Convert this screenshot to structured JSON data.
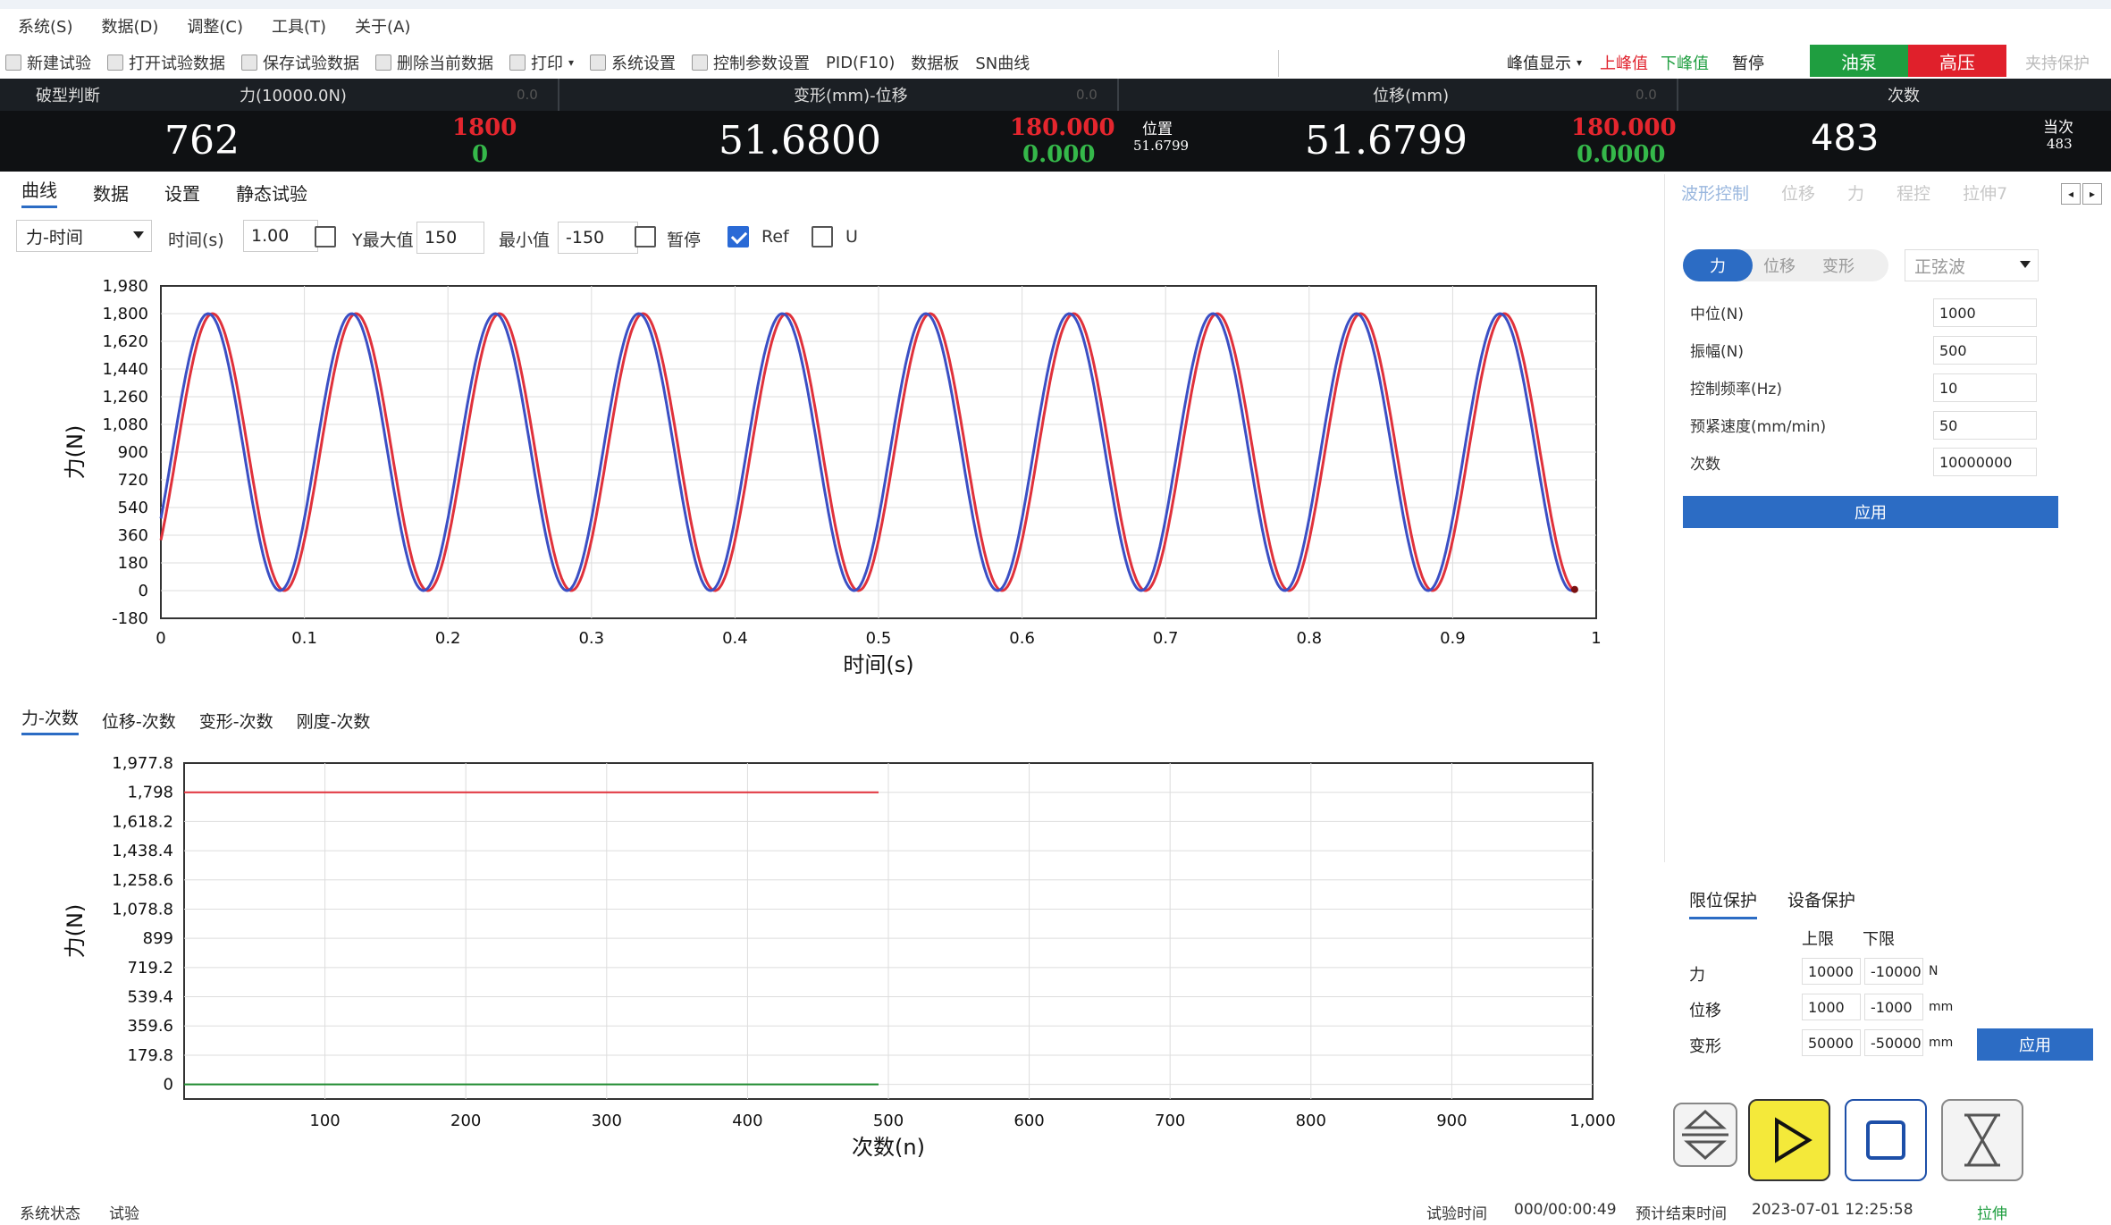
{
  "menu": [
    "系统(S)",
    "数据(D)",
    "调整(C)",
    "工具(T)",
    "关于(A)"
  ],
  "toolbar": {
    "items": [
      "新建试验",
      "打开试验数据",
      "保存试验数据",
      "删除当前数据",
      "打印",
      "系统设置",
      "控制参数设置",
      "PID(F10)",
      "数据板",
      "SN曲线"
    ],
    "peak_display": "峰值显示",
    "upper_peak": "上峰值",
    "lower_peak": "下峰值",
    "pause": "暂停",
    "oil_pump": "油泵",
    "high_pressure": "高压",
    "keep_protect": "夹持保护"
  },
  "readout": {
    "break_label": "破型判断",
    "force_label": "力(10000.0N)",
    "force_small": "0.0",
    "deform_label": "变形(mm)-位移",
    "deform_small": "0.0",
    "disp_label": "位移(mm)",
    "disp_small": "0.0",
    "count_label": "次数",
    "force_value": "762",
    "force_peak_hi": "1800",
    "force_peak_lo": "0",
    "deform_value": "51.6800",
    "deform_peak_hi": "180.000",
    "deform_peak_lo": "0.000",
    "pos_label": "位置",
    "pos_value": "51.6799",
    "disp_value": "51.6799",
    "disp_peak_hi": "180.000",
    "disp_peak_lo": "0.0000",
    "count_value": "483",
    "current_label": "当次",
    "current_value": "483"
  },
  "main_tabs": [
    "曲线",
    "数据",
    "设置",
    "静态试验"
  ],
  "controls": {
    "mode": "力-时间",
    "time_label": "时间(s)",
    "time_value": "1.00",
    "ymax_label": "Y最大值",
    "ymax_value": "150",
    "ymin_label": "最小值",
    "ymin_value": "-150",
    "pause_label": "暂停",
    "pause_checked": false,
    "ymax_checked": false,
    "ref_label": "Ref",
    "ref_checked": true,
    "u_label": "U",
    "u_checked": false
  },
  "bottom_tabs": [
    "力-次数",
    "位移-次数",
    "变形-次数",
    "刚度-次数"
  ],
  "right_panel": {
    "tabs": [
      "波形控制",
      "位移",
      "力",
      "程控",
      "拉伸7"
    ],
    "seg": [
      "力",
      "位移",
      "变形"
    ],
    "wave": "正弦波",
    "fields": [
      {
        "label": "中位(N)",
        "value": "1000"
      },
      {
        "label": "振幅(N)",
        "value": "500"
      },
      {
        "label": "控制频率(Hz)",
        "value": "10"
      },
      {
        "label": "预紧速度(mm/min)",
        "value": "50"
      },
      {
        "label": "次数",
        "value": "10000000"
      }
    ],
    "apply": "应用"
  },
  "limits": {
    "tabs": [
      "限位保护",
      "设备保护"
    ],
    "upper": "上限",
    "lower": "下限",
    "rows": [
      {
        "label": "力",
        "hi": "10000",
        "lo": "-10000",
        "unit": "N"
      },
      {
        "label": "位移",
        "hi": "1000",
        "lo": "-1000",
        "unit": "mm"
      },
      {
        "label": "变形",
        "hi": "50000",
        "lo": "-50000",
        "unit": "mm"
      }
    ],
    "apply": "应用"
  },
  "status": {
    "sys_state_label": "系统状态",
    "sys_state": "试验",
    "test_time_label": "试验时间",
    "test_time": "000/00:00:49",
    "end_time_label": "预计结束时间",
    "end_time": "2023-07-01 12:25:58",
    "mode": "拉伸"
  },
  "colors": {
    "ref_series": "#e0313b",
    "feedback_series": "#3b4fc4",
    "min_series": "#1e8a2e",
    "accent": "#2c6cc4"
  },
  "chart_data": [
    {
      "type": "line",
      "title": "",
      "xlabel": "时间(s)",
      "ylabel": "力(N)",
      "xlim": [
        0,
        1
      ],
      "ylim": [
        -180,
        1980
      ],
      "xticks": [
        "0",
        "0.1",
        "0.2",
        "0.3",
        "0.4",
        "0.5",
        "0.6",
        "0.7",
        "0.8",
        "0.9",
        "1"
      ],
      "yticks": [
        "1,980",
        "1,800",
        "1,620",
        "1,440",
        "1,260",
        "1,080",
        "900",
        "720",
        "540",
        "360",
        "180",
        "0",
        "-180"
      ],
      "series": [
        {
          "name": "Ref",
          "frequency_hz": 10,
          "min": 0,
          "max": 1800,
          "start_x": 0,
          "end_x": 0.985,
          "phase_shift": 0.0
        },
        {
          "frequency_hz": 10,
          "min": 0,
          "max": 1800,
          "start_x": 0,
          "end_x": 0.985,
          "phase_shift": 0.003
        }
      ],
      "grid": true
    },
    {
      "type": "line",
      "title": "",
      "xlabel": "次数(n)",
      "ylabel": "力(N)",
      "xlim": [
        0,
        1000
      ],
      "ylim": [
        -90,
        1977.8
      ],
      "xticks": [
        "100",
        "200",
        "300",
        "400",
        "500",
        "600",
        "700",
        "800",
        "900",
        "1,000"
      ],
      "yticks": [
        "1,977.8",
        "1,798",
        "1,618.2",
        "1,438.4",
        "1,258.6",
        "1,078.8",
        "899",
        "719.2",
        "539.4",
        "359.6",
        "179.8",
        "0"
      ],
      "series": [
        {
          "x": [
            0,
            493
          ],
          "values": [
            1798,
            1798
          ]
        },
        {
          "x": [
            0,
            493
          ],
          "values": [
            0,
            0
          ]
        }
      ],
      "grid": true
    }
  ]
}
